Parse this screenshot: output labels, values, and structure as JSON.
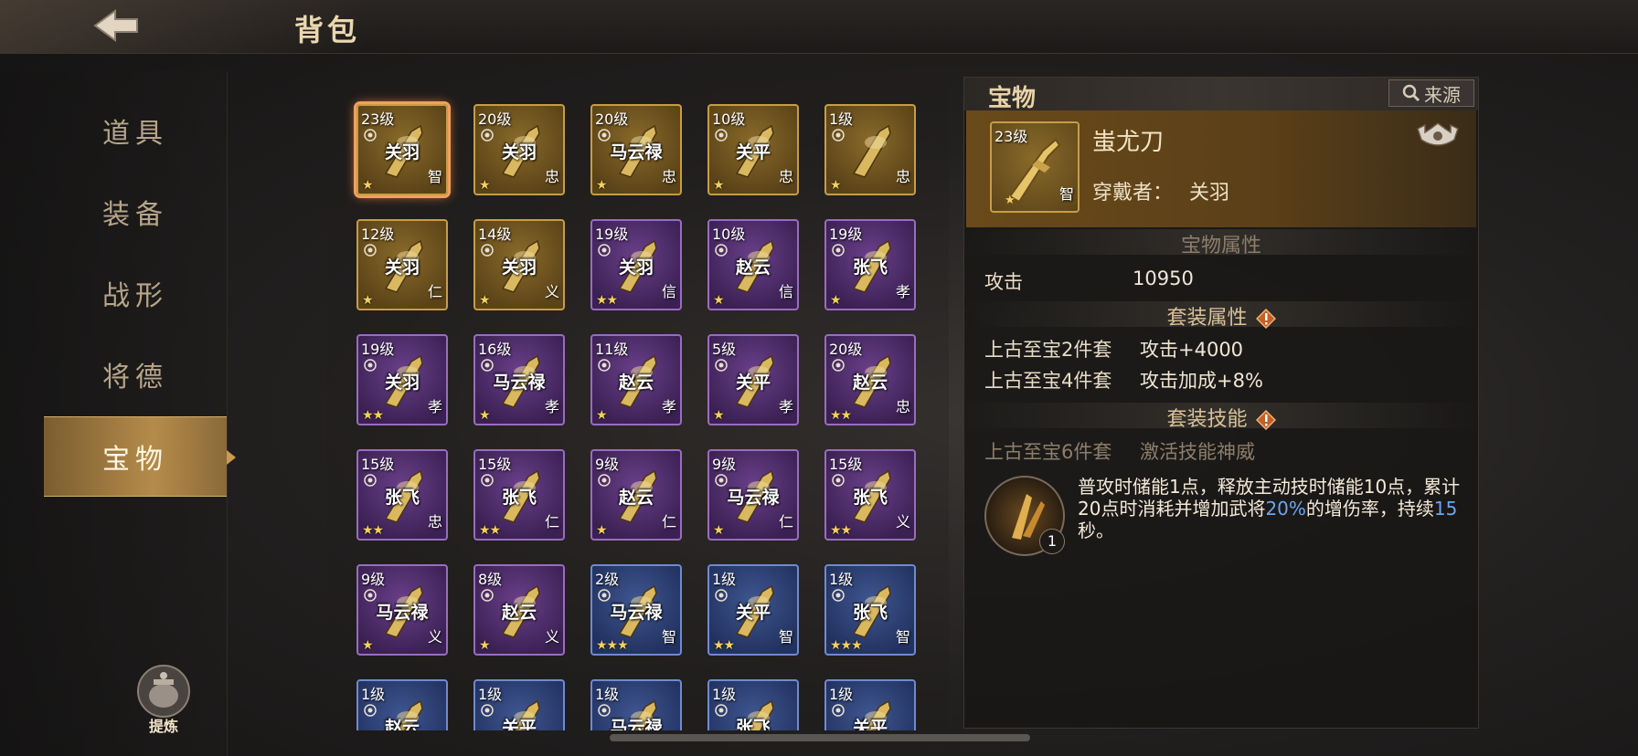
{
  "header": {
    "title": "背包"
  },
  "sidebar": {
    "items": [
      {
        "label": "道具"
      },
      {
        "label": "装备"
      },
      {
        "label": "战形"
      },
      {
        "label": "将德"
      },
      {
        "label": "宝物"
      }
    ],
    "refine_label": "提炼"
  },
  "grid": {
    "items": [
      {
        "level": "23级",
        "hero": "关羽",
        "virtue": "智",
        "rarity": "gold",
        "stars": "★",
        "selected": true
      },
      {
        "level": "20级",
        "hero": "关羽",
        "virtue": "忠",
        "rarity": "gold",
        "stars": "★"
      },
      {
        "level": "20级",
        "hero": "马云禄",
        "virtue": "忠",
        "rarity": "gold",
        "stars": "★"
      },
      {
        "level": "10级",
        "hero": "关平",
        "virtue": "忠",
        "rarity": "gold",
        "stars": "★"
      },
      {
        "level": "1级",
        "hero": "",
        "virtue": "忠",
        "rarity": "gold",
        "stars": "★"
      },
      {
        "level": "12级",
        "hero": "关羽",
        "virtue": "仁",
        "rarity": "gold",
        "stars": "★"
      },
      {
        "level": "14级",
        "hero": "关羽",
        "virtue": "义",
        "rarity": "gold",
        "stars": "★"
      },
      {
        "level": "19级",
        "hero": "关羽",
        "virtue": "信",
        "rarity": "purple",
        "stars": "★★"
      },
      {
        "level": "10级",
        "hero": "赵云",
        "virtue": "信",
        "rarity": "purple",
        "stars": "★"
      },
      {
        "level": "19级",
        "hero": "张飞",
        "virtue": "孝",
        "rarity": "purple",
        "stars": "★"
      },
      {
        "level": "19级",
        "hero": "关羽",
        "virtue": "孝",
        "rarity": "purple",
        "stars": "★★"
      },
      {
        "level": "16级",
        "hero": "马云禄",
        "virtue": "孝",
        "rarity": "purple",
        "stars": "★"
      },
      {
        "level": "11级",
        "hero": "赵云",
        "virtue": "孝",
        "rarity": "purple",
        "stars": "★"
      },
      {
        "level": "5级",
        "hero": "关平",
        "virtue": "孝",
        "rarity": "purple",
        "stars": "★"
      },
      {
        "level": "20级",
        "hero": "赵云",
        "virtue": "忠",
        "rarity": "purple",
        "stars": "★★"
      },
      {
        "level": "15级",
        "hero": "张飞",
        "virtue": "忠",
        "rarity": "purple",
        "stars": "★★"
      },
      {
        "level": "15级",
        "hero": "张飞",
        "virtue": "仁",
        "rarity": "purple",
        "stars": "★★"
      },
      {
        "level": "9级",
        "hero": "赵云",
        "virtue": "仁",
        "rarity": "purple",
        "stars": "★"
      },
      {
        "level": "9级",
        "hero": "马云禄",
        "virtue": "仁",
        "rarity": "purple",
        "stars": "★"
      },
      {
        "level": "15级",
        "hero": "张飞",
        "virtue": "义",
        "rarity": "purple",
        "stars": "★★"
      },
      {
        "level": "9级",
        "hero": "马云禄",
        "virtue": "义",
        "rarity": "purple",
        "stars": "★"
      },
      {
        "level": "8级",
        "hero": "赵云",
        "virtue": "义",
        "rarity": "purple",
        "stars": "★"
      },
      {
        "level": "2级",
        "hero": "马云禄",
        "virtue": "智",
        "rarity": "blue",
        "stars": "★★★"
      },
      {
        "level": "1级",
        "hero": "关平",
        "virtue": "智",
        "rarity": "blue",
        "stars": "★★"
      },
      {
        "level": "1级",
        "hero": "张飞",
        "virtue": "智",
        "rarity": "blue",
        "stars": "★★★"
      },
      {
        "level": "1级",
        "hero": "赵云",
        "virtue": "",
        "rarity": "blue",
        "stars": ""
      },
      {
        "level": "1级",
        "hero": "关平",
        "virtue": "",
        "rarity": "blue",
        "stars": ""
      },
      {
        "level": "1级",
        "hero": "马云禄",
        "virtue": "",
        "rarity": "blue",
        "stars": ""
      },
      {
        "level": "1级",
        "hero": "张飞",
        "virtue": "",
        "rarity": "blue",
        "stars": ""
      },
      {
        "level": "1级",
        "hero": "关平",
        "virtue": "",
        "rarity": "blue",
        "stars": ""
      }
    ]
  },
  "detail": {
    "title": "宝物",
    "source_label": "来源",
    "item": {
      "level": "23级",
      "virtue": "智",
      "name": "蚩尤刀",
      "wearer_label": "穿戴者：",
      "wearer": "关羽"
    },
    "attr_title": "宝物属性",
    "attrs": [
      {
        "label": "攻击",
        "value": "10950"
      }
    ],
    "set_title": "套装属性",
    "set_bonuses": [
      {
        "label": "上古至宝2件套",
        "value": "攻击+4000"
      },
      {
        "label": "上古至宝4件套",
        "value": "攻击加成+8%"
      }
    ],
    "skill_title": "套装技能",
    "skill": {
      "label": "上古至宝6件套",
      "value": "激活技能神威",
      "count": "1",
      "desc_a": "普攻时储能1点，释放主动技时储能10点，累计20点时消耗并增加武将",
      "desc_pct": "20%",
      "desc_b": "的增伤率，持续",
      "desc_sec": "15",
      "desc_c": "秒。"
    }
  },
  "colors": {
    "accent_gold": "#c79d45",
    "purple_frame": "#9a6cc0",
    "blue_frame": "#6f8ad0",
    "highlight_blue": "#6aa6f0"
  }
}
